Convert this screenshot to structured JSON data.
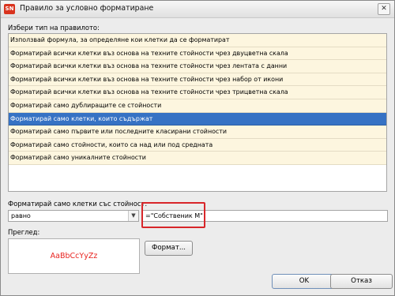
{
  "window": {
    "title": "Правило за условно форматиране",
    "app_icon_text": "SN",
    "close_symbol": "✕"
  },
  "rule_type": {
    "label": "Избери тип на правилото:",
    "items": [
      "Използвай формула, за определяне кои клетки да се форматират",
      "Форматирай всички клетки въз основа на техните стойности чрез двуцветна скала",
      "Форматирай всички клетки въз основа на техните стойности чрез лентата с данни",
      "Форматирай всички клетки въз основа на техните стойности чрез набор от икони",
      "Форматирай всички клетки въз основа на техните стойности чрез трицветна скала",
      "Форматирай само дублиращите се стойности",
      "Форматирай само клетки, които съдържат",
      "Форматирай само първите или последните класирани стойности",
      "Форматирай само стойности, които са над или под средната",
      "Форматирай само уникалните стойности"
    ],
    "selected_index": 6
  },
  "condition": {
    "label": "Форматирай само клетки със стойност:",
    "operator": "равно",
    "value": "=\"Собственик М\""
  },
  "preview": {
    "label": "Преглед:",
    "sample_text": "AaBbCcYyZz",
    "sample_color": "#e8231f"
  },
  "buttons": {
    "format": "Формат...",
    "ok": "OK",
    "cancel": "Отказ"
  },
  "colors": {
    "selection": "#3672c4",
    "item_background": "#fdf6df",
    "highlight_border": "#d8262a"
  }
}
